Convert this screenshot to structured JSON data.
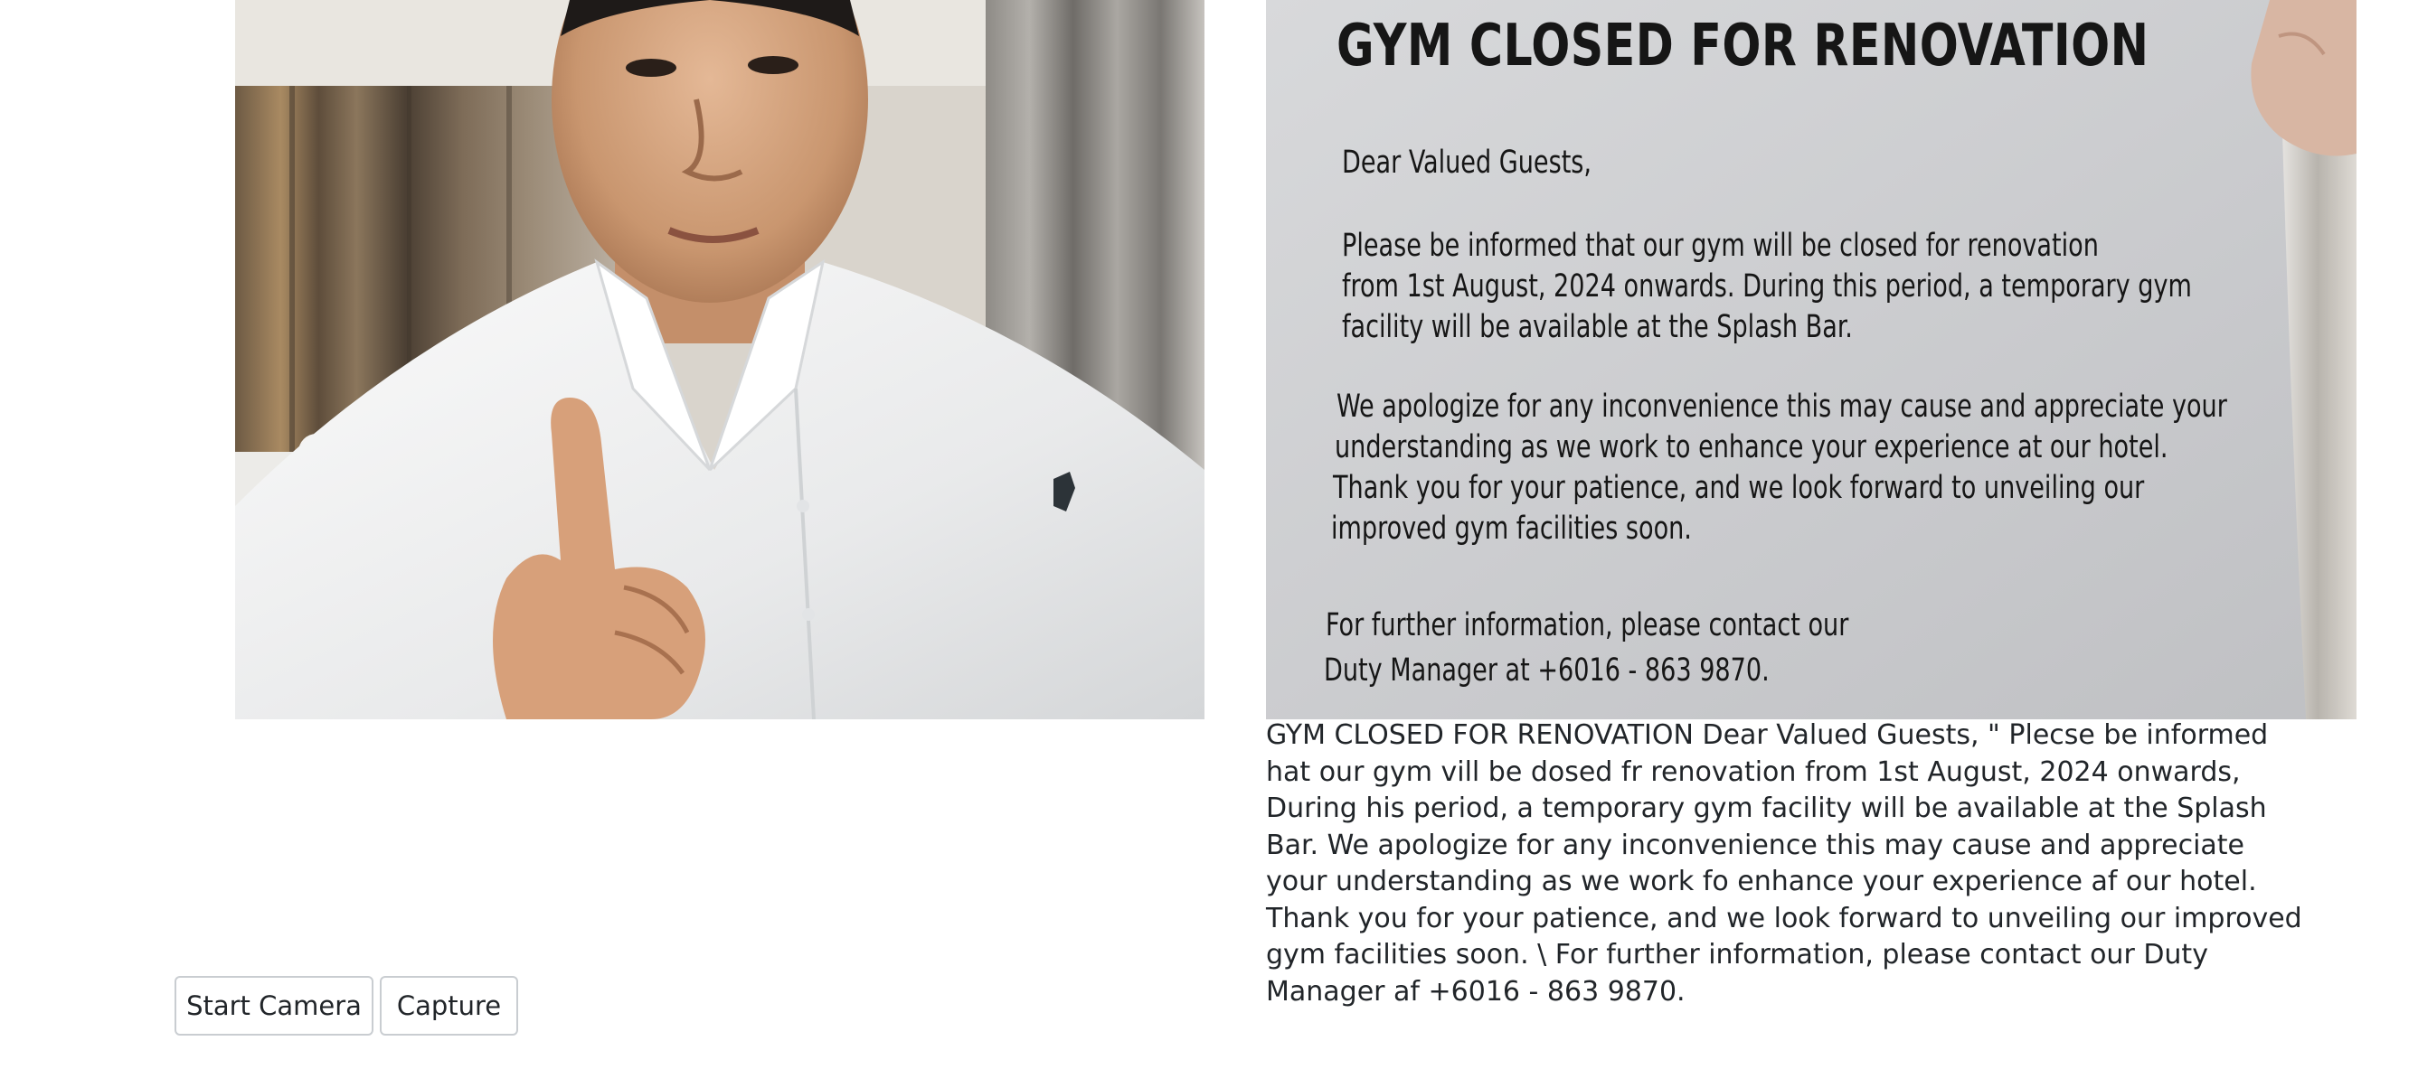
{
  "camera": {
    "subject": "camera-preview-person"
  },
  "notice": {
    "title": "GYM CLOSED FOR RENOVATION",
    "greeting": "Dear Valued Guests,",
    "p1": [
      "Please be informed that our gym will be closed for renovation",
      "from 1st August, 2024 onwards. During this period, a temporary gym",
      "facility will be available at the Splash Bar."
    ],
    "p2": [
      "We apologize for any inconvenience this may cause and appreciate your",
      "understanding as we work to enhance your experience at our hotel.",
      "Thank you for your patience, and we look forward to unveiling our",
      "improved gym facilities soon."
    ],
    "p3": [
      "For further information, please contact our",
      "Duty Manager at +6016 - 863 9870."
    ]
  },
  "ocr": {
    "text": "GYM CLOSED FOR RENOVATION Dear Valued Guests, \" Plecse be informed hat our gym vill be dosed fr renovation from 1st August, 2024 onwards, During his period, a temporary gym facility will be available at the Splash Bar. We apologize for any inconvenience this may cause and appreciate your understanding as we work fo enhance your experience af our hotel. Thank you for your patience, and we look forward to unveiling our improved gym facilities soon. \\ For further information, please contact our Duty Manager af +6016 - 863 9870."
  },
  "buttons": {
    "start_camera": "Start Camera",
    "capture": "Capture"
  },
  "colors": {
    "text": "#212529",
    "button_border": "#c9cdd1",
    "paper": "#d2d3d5",
    "shirt": "#f1f2f2"
  }
}
